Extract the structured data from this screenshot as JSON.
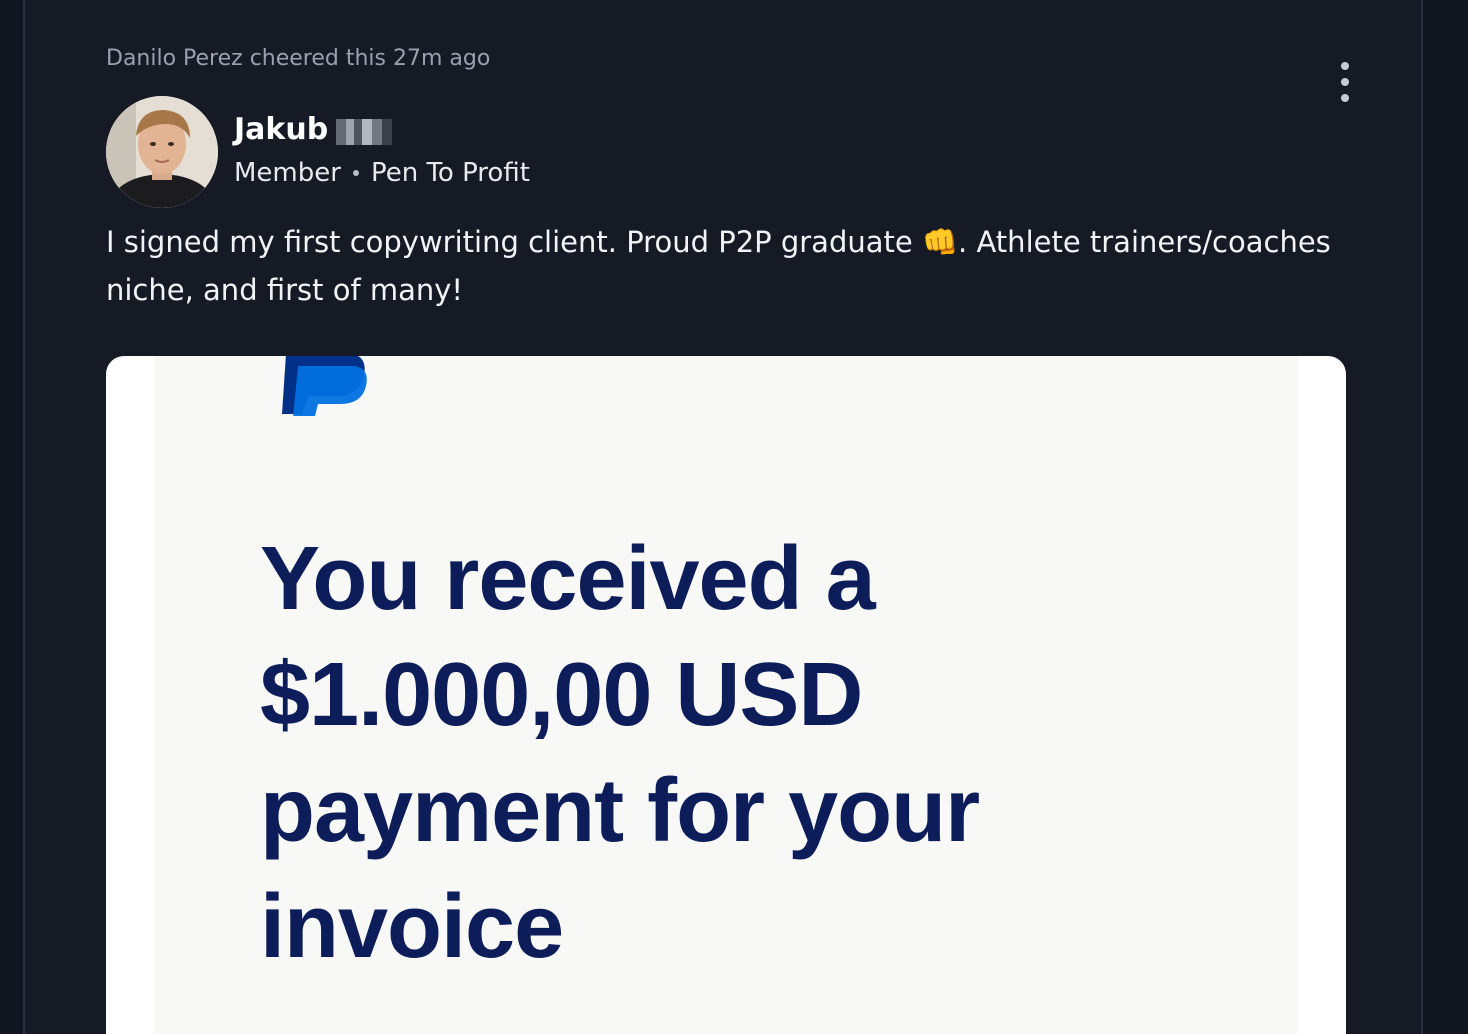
{
  "post": {
    "activity": "Danilo Perez cheered this 27m ago",
    "author": {
      "name": "Jakub",
      "role": "Member",
      "group": "Pen To Profit"
    },
    "body_part1": "I signed my first copywriting client. Proud P2P graduate ",
    "emoji": "👊",
    "body_part2": ". Athlete trainers/coaches niche, and first of many!"
  },
  "image": {
    "line1": "You received a",
    "line2": "$1.000,00 USD",
    "line3": "payment for your",
    "line4": "invoice"
  },
  "colors": {
    "background": "#121621",
    "card": "#151a25",
    "muted_text": "#9aa1ad",
    "receipt_text": "#0c1d5a",
    "paypal_blue_dark": "#003087",
    "paypal_blue_light": "#0070e0"
  },
  "icons": {
    "more": "vertical-ellipsis-icon",
    "logo": "paypal-logo"
  }
}
